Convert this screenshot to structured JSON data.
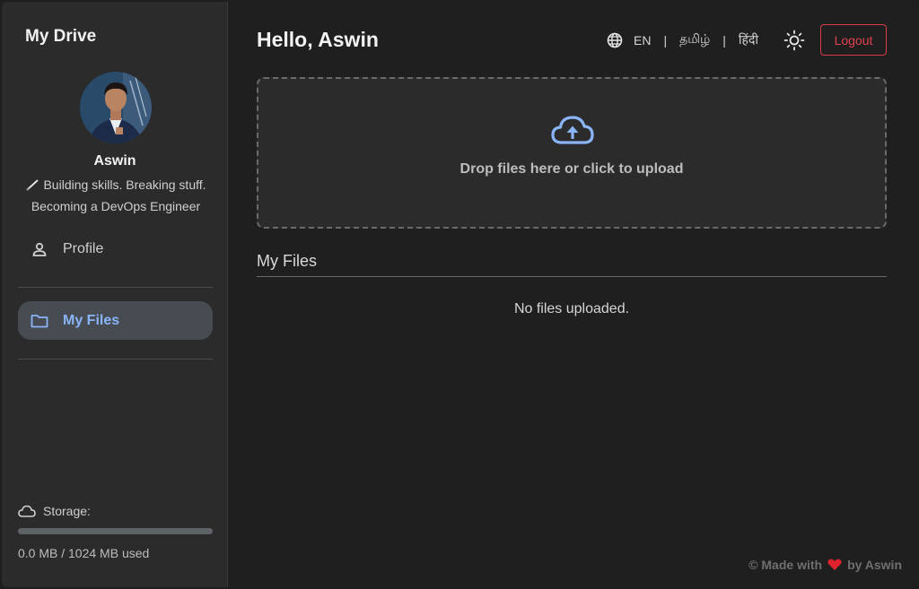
{
  "sidebar": {
    "brand": "My Drive",
    "user": {
      "name": "Aswin",
      "bio": "Building skills. Breaking stuff. Becoming a DevOps Engineer"
    },
    "nav": {
      "profile": {
        "label": "Profile",
        "icon": "person-icon"
      },
      "files": {
        "label": "My Files",
        "icon": "folder-icon",
        "active": true
      }
    },
    "storage": {
      "label": "Storage:",
      "used_text": "0.0 MB / 1024 MB used",
      "used_fraction": 0.0
    }
  },
  "header": {
    "greeting": "Hello, Aswin",
    "languages": [
      "EN",
      "தமிழ்",
      "हिंदी"
    ],
    "separator": "|",
    "logout_label": "Logout"
  },
  "upload": {
    "text": "Drop files here or click to upload",
    "icon": "cloud-upload-icon"
  },
  "files": {
    "title": "My Files",
    "empty_text": "No files uploaded."
  },
  "footer": {
    "before": "© Made with",
    "after": "by Aswin"
  },
  "colors": {
    "accent": "#8ab4f8",
    "danger": "#e3424f",
    "heart": "#e0212e"
  }
}
